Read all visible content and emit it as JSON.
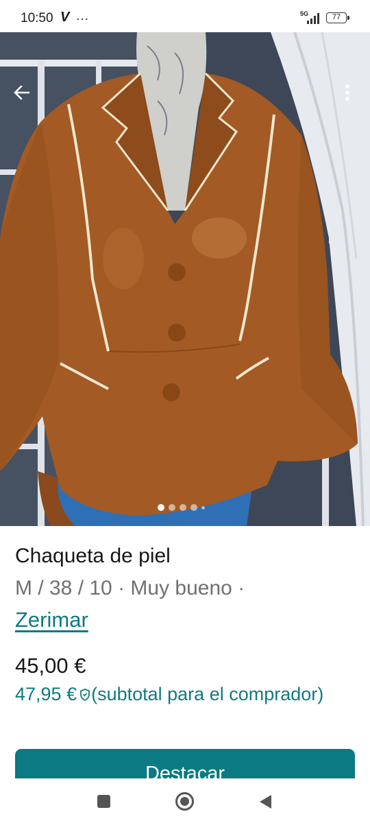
{
  "status_bar": {
    "time": "10:50",
    "carrier_icon": "V",
    "more_notifications": "…",
    "network": "5G",
    "battery": "77"
  },
  "photo": {
    "back_icon": "arrow-left-icon",
    "menu_icon": "more-vertical-icon",
    "carousel": {
      "total": 5,
      "active": 1
    }
  },
  "item": {
    "title": "Chaqueta de piel",
    "details": "M / 38 / 10 · Muy bueno ·",
    "brand": "Zerimar",
    "price": "45,00 €",
    "buyer_price": "47,95 €",
    "buyer_note": "(subtotal para el comprador)"
  },
  "actions": {
    "highlight": "Destacar"
  },
  "colors": {
    "accent": "#0f7a82",
    "button": "#0b7a82",
    "leather": "#a35a24"
  }
}
